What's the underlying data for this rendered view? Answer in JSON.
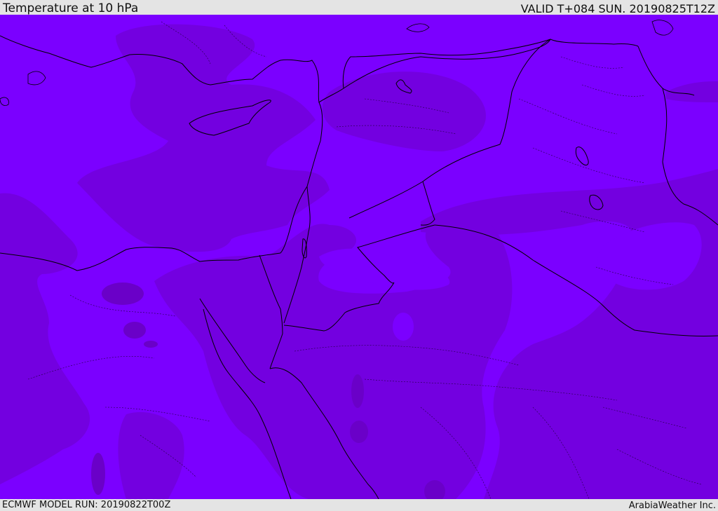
{
  "header": {
    "title": "Temperature at 10 hPa",
    "valid_time": "VALID T+084 SUN. 20190825T12Z"
  },
  "footer": {
    "model_run": "ECMWF MODEL RUN: 20190822T00Z",
    "provider": "ArabiaWeather Inc."
  },
  "colors": {
    "light_band": "#7b00ff",
    "dark_band": "#7300e0",
    "darkest_band": "#6a00c8",
    "border_line": "#000000",
    "header_bg": "#e4e4e4"
  }
}
